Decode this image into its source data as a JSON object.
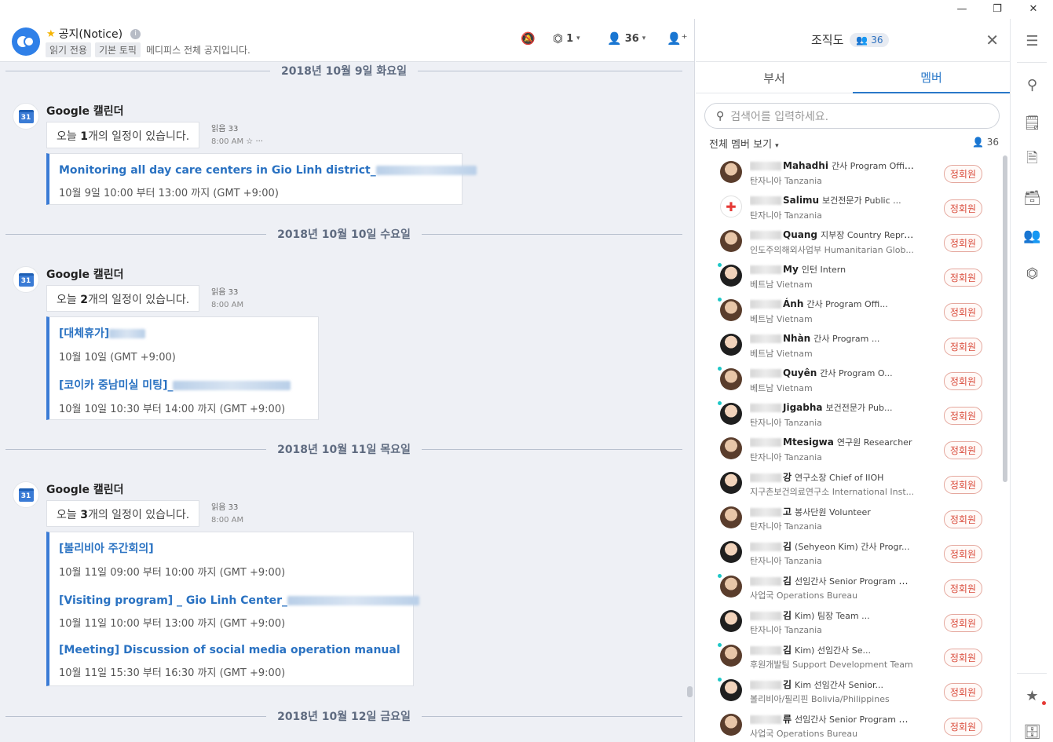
{
  "window": {
    "minimize": "—",
    "maximize": "❐",
    "close": "✕"
  },
  "header": {
    "room_name": "공지(Notice)",
    "tag_readonly": "읽기 전용",
    "tag_default": "기본 토픽",
    "description": "메디피스 전체 공지입니다.",
    "integrations_count": "1",
    "members_count": "36"
  },
  "dates": [
    "2018년 10월 9일 화요일",
    "2018년 10월 10일 수요일",
    "2018년 10월 11일 목요일",
    "2018년 10월 12일 금요일"
  ],
  "messages": [
    {
      "sender": "Google 캘린더",
      "avatar_label": "31",
      "text_prefix": "오늘 ",
      "count": "1",
      "text_suffix": "개의 일정이 있습니다.",
      "read": "읽음 33",
      "time": "8:00 AM",
      "events": [
        {
          "title": "Monitoring all day care centers in Gio Linh district_",
          "when": "10월 9일 10:00 부터 13:00 까지 (GMT +9:00)"
        }
      ]
    },
    {
      "sender": "Google 캘린더",
      "avatar_label": "31",
      "text_prefix": "오늘 ",
      "count": "2",
      "text_suffix": "개의 일정이 있습니다.",
      "read": "읽음 33",
      "time": "8:00 AM",
      "events": [
        {
          "title": "[대체휴가]",
          "when": "10월 10일 (GMT +9:00)"
        },
        {
          "title": "[코이카 중남미실 미팅]_",
          "when": "10월 10일 10:30 부터 14:00 까지 (GMT +9:00)"
        }
      ]
    },
    {
      "sender": "Google 캘린더",
      "avatar_label": "31",
      "text_prefix": "오늘 ",
      "count": "3",
      "text_suffix": "개의 일정이 있습니다.",
      "read": "읽음 33",
      "time": "8:00 AM",
      "events": [
        {
          "title": "[볼리비아 주간회의]",
          "when": "10월 11일 09:00 부터 10:00 까지 (GMT +9:00)"
        },
        {
          "title": "[Visiting program] _ Gio Linh Center_",
          "when": "10월 11일 10:00 부터 13:00 까지 (GMT +9:00)"
        },
        {
          "title": "[Meeting] Discussion of social media operation manual",
          "when": "10월 11일 15:30 부터 16:30 까지 (GMT +9:00)"
        }
      ]
    }
  ],
  "org": {
    "title": "조직도",
    "count": "36",
    "tab_dept": "부서",
    "tab_members": "멤버",
    "search_placeholder": "검색어를 입력하세요.",
    "filter_label": "전체 멤버 보기",
    "filter_count": "36",
    "badge": "정회원",
    "members": [
      {
        "name": "Mahadhi",
        "role": "간사 Program Officer",
        "dept": "탄자니아 Tanzania",
        "online": false
      },
      {
        "name": "Salimu",
        "role": "보건전문가 Public ...",
        "dept": "탄자니아 Tanzania",
        "online": false
      },
      {
        "name": "Quang",
        "role": "지부장 Country Repre...",
        "dept": "인도주의해외사업부 Humanitarian Glob...",
        "online": false
      },
      {
        "name": "My",
        "role": "인턴 Intern",
        "dept": "베트남 Vietnam",
        "online": true
      },
      {
        "name": "Ánh",
        "role": "간사 Program Offi...",
        "dept": "베트남 Vietnam",
        "online": true
      },
      {
        "name": "Nhàn",
        "role": "간사 Program ...",
        "dept": "베트남 Vietnam",
        "online": false
      },
      {
        "name": "Quyên",
        "role": "간사 Program O...",
        "dept": "베트남 Vietnam",
        "online": true
      },
      {
        "name": "Jigabha",
        "role": "보건전문가 Pub...",
        "dept": "탄자니아 Tanzania",
        "online": true
      },
      {
        "name": "Mtesigwa",
        "role": "연구원 Researcher",
        "dept": "탄자니아 Tanzania",
        "online": false
      },
      {
        "name": "강",
        "role": "연구소장 Chief of IIOH",
        "dept": "지구촌보건의료연구소 International Inst...",
        "online": false
      },
      {
        "name": "고",
        "role": "봉사단원 Volunteer",
        "dept": "탄자니아 Tanzania",
        "online": false
      },
      {
        "name": "김",
        "role": "(Sehyeon Kim) 간사 Progr...",
        "dept": "탄자니아 Tanzania",
        "online": false
      },
      {
        "name": "김",
        "role": "선임간사 Senior Program Officer",
        "dept": "사업국 Operations Bureau",
        "online": true
      },
      {
        "name": "김",
        "role": "Kim) 팀장 Team ...",
        "dept": "탄자니아 Tanzania",
        "online": false
      },
      {
        "name": "김",
        "role": "Kim) 선임간사 Se...",
        "dept": "후원개발팀 Support Development Team",
        "online": true
      },
      {
        "name": "김",
        "role": "Kim 선임간사 Senior...",
        "dept": "볼리비아/필리핀 Bolivia/Philippines",
        "online": true
      },
      {
        "name": "류",
        "role": "선임간사 Senior Program Officer",
        "dept": "사업국 Operations Bureau",
        "online": false
      }
    ]
  },
  "rail": [
    "menu-icon",
    "search-icon",
    "memo-icon",
    "file-icon",
    "archive-icon",
    "members-icon",
    "integration-icon",
    "star-icon",
    "inbox-icon"
  ]
}
